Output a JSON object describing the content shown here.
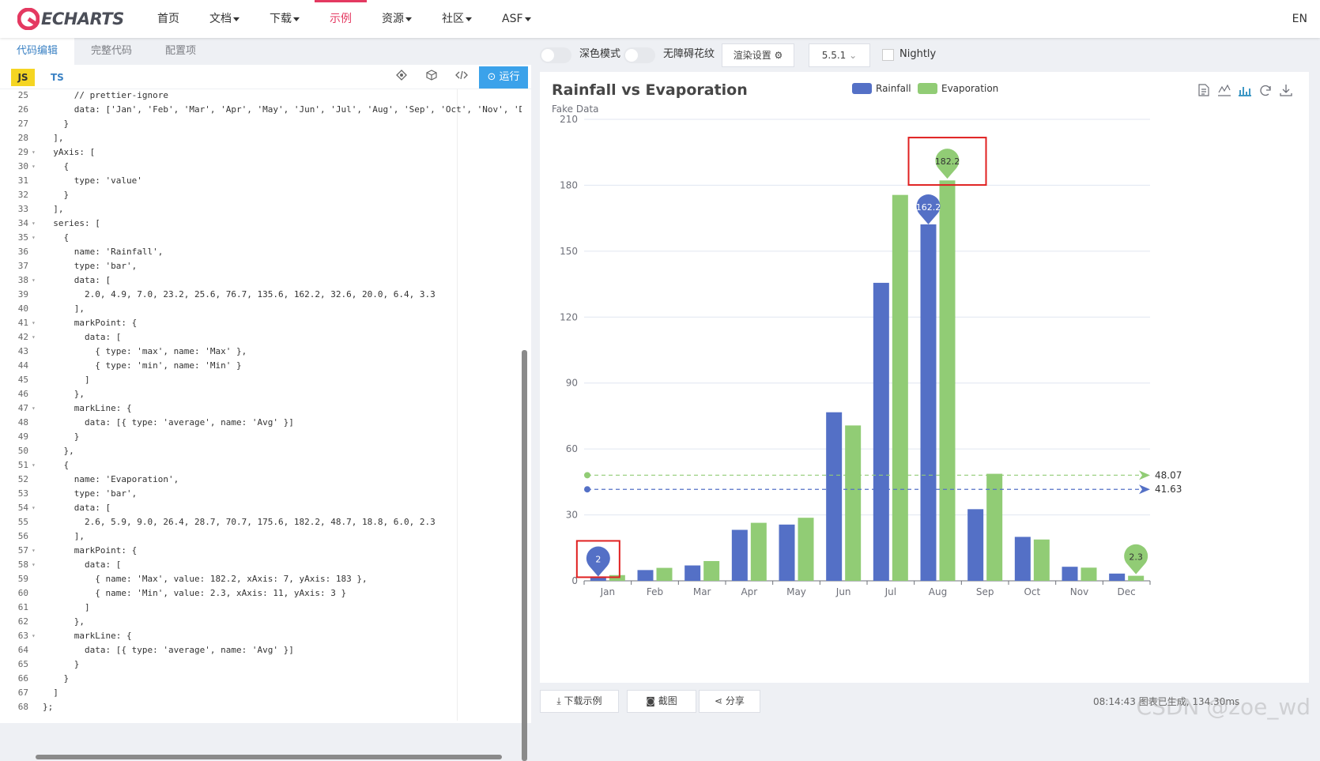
{
  "navbar": {
    "brand": "ECHARTS",
    "items": [
      {
        "label": "首页",
        "caret": false,
        "active": false
      },
      {
        "label": "文档",
        "caret": true,
        "active": false
      },
      {
        "label": "下载",
        "caret": true,
        "active": false
      },
      {
        "label": "示例",
        "caret": false,
        "active": true
      },
      {
        "label": "资源",
        "caret": true,
        "active": false
      },
      {
        "label": "社区",
        "caret": true,
        "active": false
      },
      {
        "label": "ASF",
        "caret": true,
        "active": false
      }
    ],
    "lang": "EN"
  },
  "editor": {
    "tabs": [
      "代码编辑",
      "完整代码",
      "配置项"
    ],
    "lang_js": "JS",
    "lang_ts": "TS",
    "run_label": "运行",
    "lines": [
      {
        "n": 25,
        "fold": false,
        "text": "      // prettier-ignore"
      },
      {
        "n": 26,
        "fold": false,
        "text": "      data: ['Jan', 'Feb', 'Mar', 'Apr', 'May', 'Jun', 'Jul', 'Aug', 'Sep', 'Oct', 'Nov', 'De"
      },
      {
        "n": 27,
        "fold": false,
        "text": "    }"
      },
      {
        "n": 28,
        "fold": false,
        "text": "  ],"
      },
      {
        "n": 29,
        "fold": true,
        "text": "  yAxis: ["
      },
      {
        "n": 30,
        "fold": true,
        "text": "    {"
      },
      {
        "n": 31,
        "fold": false,
        "text": "      type: 'value'"
      },
      {
        "n": 32,
        "fold": false,
        "text": "    }"
      },
      {
        "n": 33,
        "fold": false,
        "text": "  ],"
      },
      {
        "n": 34,
        "fold": true,
        "text": "  series: ["
      },
      {
        "n": 35,
        "fold": true,
        "text": "    {"
      },
      {
        "n": 36,
        "fold": false,
        "text": "      name: 'Rainfall',"
      },
      {
        "n": 37,
        "fold": false,
        "text": "      type: 'bar',"
      },
      {
        "n": 38,
        "fold": true,
        "text": "      data: ["
      },
      {
        "n": 39,
        "fold": false,
        "text": "        2.0, 4.9, 7.0, 23.2, 25.6, 76.7, 135.6, 162.2, 32.6, 20.0, 6.4, 3.3"
      },
      {
        "n": 40,
        "fold": false,
        "text": "      ],"
      },
      {
        "n": 41,
        "fold": true,
        "text": "      markPoint: {"
      },
      {
        "n": 42,
        "fold": true,
        "text": "        data: ["
      },
      {
        "n": 43,
        "fold": false,
        "text": "          { type: 'max', name: 'Max' },"
      },
      {
        "n": 44,
        "fold": false,
        "text": "          { type: 'min', name: 'Min' }"
      },
      {
        "n": 45,
        "fold": false,
        "text": "        ]"
      },
      {
        "n": 46,
        "fold": false,
        "text": "      },"
      },
      {
        "n": 47,
        "fold": true,
        "text": "      markLine: {"
      },
      {
        "n": 48,
        "fold": false,
        "text": "        data: [{ type: 'average', name: 'Avg' }]"
      },
      {
        "n": 49,
        "fold": false,
        "text": "      }"
      },
      {
        "n": 50,
        "fold": false,
        "text": "    },"
      },
      {
        "n": 51,
        "fold": true,
        "text": "    {"
      },
      {
        "n": 52,
        "fold": false,
        "text": "      name: 'Evaporation',"
      },
      {
        "n": 53,
        "fold": false,
        "text": "      type: 'bar',"
      },
      {
        "n": 54,
        "fold": true,
        "text": "      data: ["
      },
      {
        "n": 55,
        "fold": false,
        "text": "        2.6, 5.9, 9.0, 26.4, 28.7, 70.7, 175.6, 182.2, 48.7, 18.8, 6.0, 2.3"
      },
      {
        "n": 56,
        "fold": false,
        "text": "      ],"
      },
      {
        "n": 57,
        "fold": true,
        "text": "      markPoint: {"
      },
      {
        "n": 58,
        "fold": true,
        "text": "        data: ["
      },
      {
        "n": 59,
        "fold": false,
        "text": "          { name: 'Max', value: 182.2, xAxis: 7, yAxis: 183 },"
      },
      {
        "n": 60,
        "fold": false,
        "text": "          { name: 'Min', value: 2.3, xAxis: 11, yAxis: 3 }"
      },
      {
        "n": 61,
        "fold": false,
        "text": "        ]"
      },
      {
        "n": 62,
        "fold": false,
        "text": "      },"
      },
      {
        "n": 63,
        "fold": true,
        "text": "      markLine: {"
      },
      {
        "n": 64,
        "fold": false,
        "text": "        data: [{ type: 'average', name: 'Avg' }]"
      },
      {
        "n": 65,
        "fold": false,
        "text": "      }"
      },
      {
        "n": 66,
        "fold": false,
        "text": "    }"
      },
      {
        "n": 67,
        "fold": false,
        "text": "  ]"
      },
      {
        "n": 68,
        "fold": false,
        "text": "};"
      }
    ]
  },
  "preview_toolbar": {
    "dark_mode_label": "深色模式",
    "a11y_label": "无障碍花纹",
    "render_label": "渲染设置",
    "version": "5.5.1",
    "nightly_label": "Nightly"
  },
  "bottom_bar": {
    "download_label": "下载示例",
    "screenshot_label": "截图",
    "share_label": "分享",
    "status": "08:14:43  图表已生成, 134.30ms"
  },
  "watermark": "CSDN @zoe_wd",
  "colors": {
    "rainfall": "#5470c6",
    "evaporation": "#91cc75",
    "accent": "#e43961",
    "run": "#3ba2ea",
    "highlight_box": "#e02020"
  },
  "chart_data": {
    "type": "bar",
    "title": "Rainfall vs Evaporation",
    "subtitle": "Fake Data",
    "categories": [
      "Jan",
      "Feb",
      "Mar",
      "Apr",
      "May",
      "Jun",
      "Jul",
      "Aug",
      "Sep",
      "Oct",
      "Nov",
      "Dec"
    ],
    "series": [
      {
        "name": "Rainfall",
        "values": [
          2.0,
          4.9,
          7.0,
          23.2,
          25.6,
          76.7,
          135.6,
          162.2,
          32.6,
          20.0,
          6.4,
          3.3
        ]
      },
      {
        "name": "Evaporation",
        "values": [
          2.6,
          5.9,
          9.0,
          26.4,
          28.7,
          70.7,
          175.6,
          182.2,
          48.7,
          18.8,
          6.0,
          2.3
        ]
      }
    ],
    "ylim": [
      0,
      210
    ],
    "yticks": [
      0,
      30,
      60,
      90,
      120,
      150,
      180,
      210
    ],
    "grid": true,
    "legend_position": "top-center",
    "mark_points": [
      {
        "series": 0,
        "category": 7,
        "value": 162.2,
        "label": "162.2"
      },
      {
        "series": 0,
        "category": 0,
        "value": 2.0,
        "label": "2"
      },
      {
        "series": 1,
        "category": 7,
        "value": 183,
        "label": "182.2"
      },
      {
        "series": 1,
        "category": 11,
        "value": 3,
        "label": "2.3"
      }
    ],
    "mark_lines": [
      {
        "series": 1,
        "value": 48.07,
        "label": "48.07"
      },
      {
        "series": 0,
        "value": 41.63,
        "label": "41.63"
      }
    ],
    "highlighted_points": [
      2,
      1
    ]
  }
}
